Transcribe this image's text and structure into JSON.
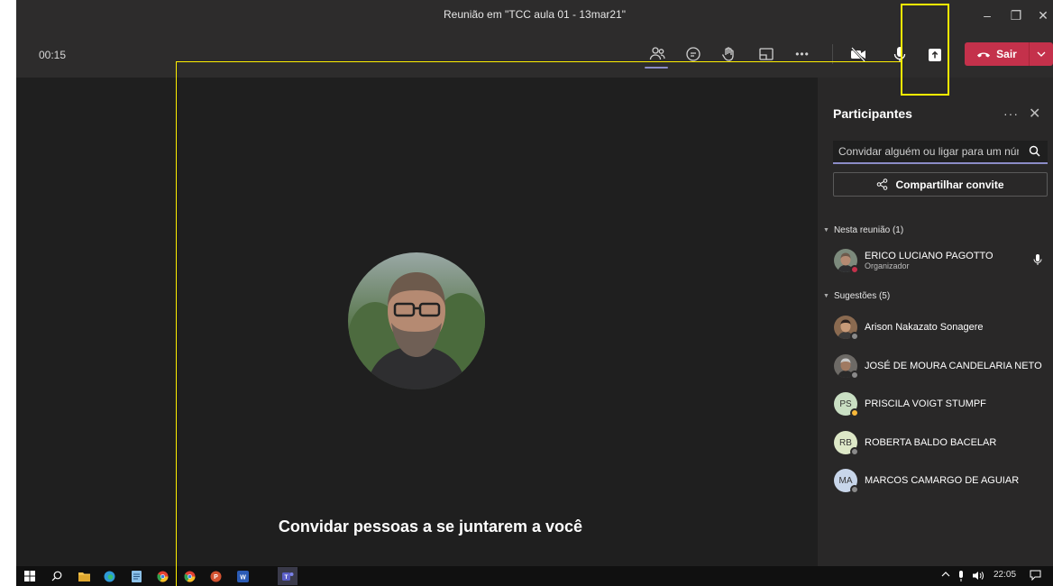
{
  "window": {
    "title": "Reunião em \"TCC aula 01 - 13mar21\"",
    "minimize_glyph": "–",
    "maximize_glyph": "❐",
    "close_glyph": "✕"
  },
  "toolbar": {
    "timer": "00:15",
    "buttons": [
      "people-icon",
      "chat-icon",
      "raise-hand-icon",
      "rooms-icon",
      "more-icon",
      "camera-off-icon",
      "mic-icon",
      "share-icon"
    ],
    "more_glyph": "•••",
    "leave_label": "Sair"
  },
  "stage": {
    "invite_text": "Convidar pessoas a se juntarem a você"
  },
  "panel": {
    "title": "Participantes",
    "more_glyph": "···",
    "close_glyph": "✕",
    "invite_placeholder": "Convidar alguém ou ligar para um núm",
    "share_invite_label": "Compartilhar convite",
    "in_meeting_label": "Nesta reunião (1)",
    "in_meeting": [
      {
        "name": "ERICO LUCIANO PAGOTTO",
        "role": "Organizador",
        "status_color": "#c4314b"
      }
    ],
    "suggestions_label": "Sugestões (5)",
    "suggestions": [
      {
        "name": "Arison Nakazato Sonagere",
        "initials": "",
        "avatar_color": "#8a6a50",
        "status_color": "#8a8a8a"
      },
      {
        "name": "JOSÉ DE MOURA CANDELARIA NETO",
        "initials": "",
        "avatar_color": "#6d6a66",
        "status_color": "#8a8a8a"
      },
      {
        "name": "PRISCILA VOIGT STUMPF",
        "initials": "PS",
        "avatar_color": "#c9dfc3",
        "status_color": "#f8b83a"
      },
      {
        "name": "ROBERTA BALDO BACELAR",
        "initials": "RB",
        "avatar_color": "#dde8c7",
        "status_color": "#8a8a8a"
      },
      {
        "name": "MARCOS CAMARGO DE AGUIAR",
        "initials": "MA",
        "avatar_color": "#c8d6ea",
        "status_color": "#8a8a8a"
      }
    ]
  },
  "taskbar": {
    "apps": [
      "windows-start-icon",
      "search-icon",
      "file-explorer-icon",
      "edge-icon",
      "notepad-icon",
      "chrome-icon",
      "chrome-icon",
      "powerpoint-icon",
      "word-icon",
      "teams-icon"
    ],
    "time": "22:05"
  },
  "colors": {
    "accent": "#8b8cc7",
    "leave": "#c4314b",
    "highlight": "#fff000"
  }
}
